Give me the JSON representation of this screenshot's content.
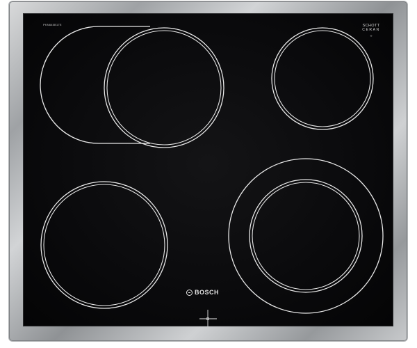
{
  "product": {
    "brand_name": "BOSCH",
    "glass_brand": {
      "line1": "SCHOTT",
      "line2": "CERAN",
      "line3": "®"
    },
    "model_label": "PKN645B17E",
    "controls": "knob-controlled (no touch controls visible)"
  },
  "surface": {
    "glass_color": "#0a0a0c",
    "frame_color": "#b8bbbe",
    "zone_line_color": "#e8e8e8"
  },
  "cooking_zones": [
    {
      "name": "rear-left-extended-zone",
      "type": "dual-oval"
    },
    {
      "name": "rear-right-zone",
      "type": "single"
    },
    {
      "name": "front-left-zone",
      "type": "single"
    },
    {
      "name": "front-right-zone",
      "type": "dual-ring"
    }
  ],
  "icons": {
    "brand_logo": "bosch-armature-logo-icon",
    "zone_marker": "zone-position-indicator-icon"
  }
}
